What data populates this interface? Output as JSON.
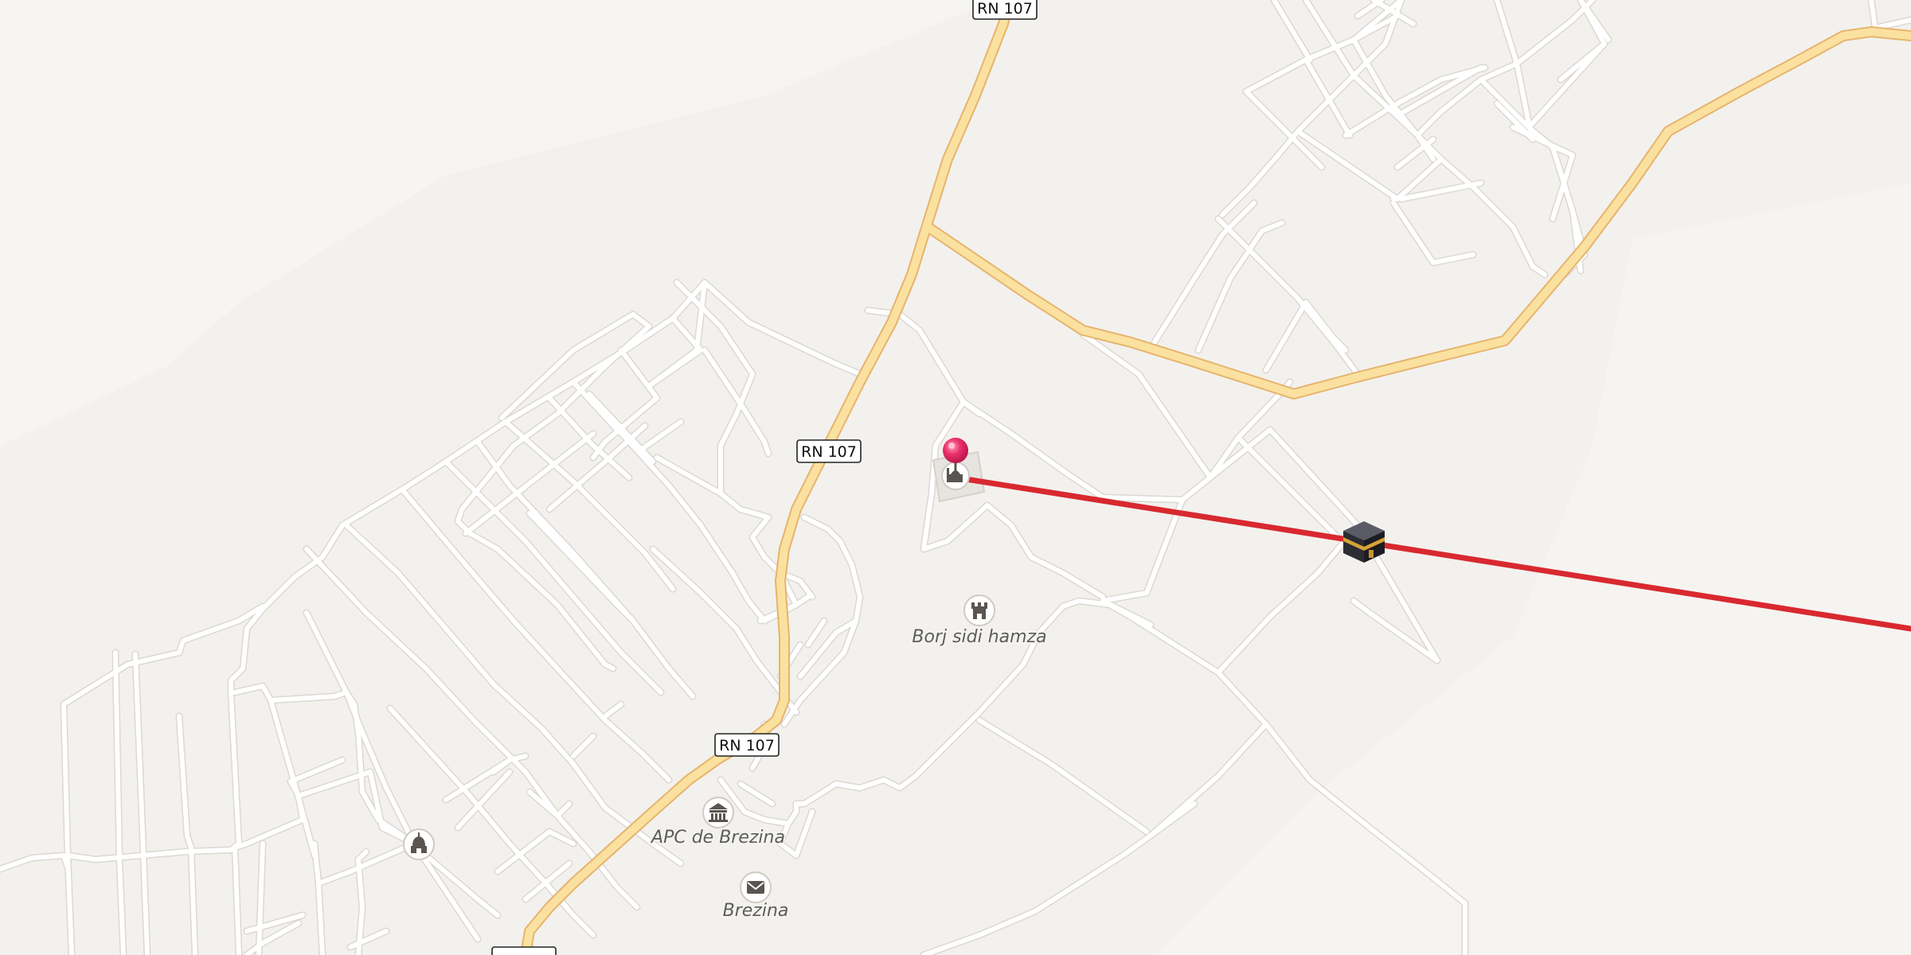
{
  "map": {
    "road_shields": [
      {
        "id": "top",
        "label": "RN 107"
      },
      {
        "id": "middle",
        "label": "RN 107"
      },
      {
        "id": "lower",
        "label": "RN 107"
      }
    ],
    "pois": [
      {
        "id": "borj",
        "label": "Borj sidi hamza",
        "icon": "tower-icon"
      },
      {
        "id": "apc",
        "label": "APC de Brezina",
        "icon": "government-building-icon"
      },
      {
        "id": "post",
        "label": "Brezina",
        "icon": "mail-icon"
      },
      {
        "id": "mosque",
        "label": "",
        "icon": "mosque-icon"
      }
    ],
    "markers": {
      "location_pin": {
        "icon": "location-pin-icon",
        "color": "#e5306a"
      },
      "qibla_target": {
        "icon": "kaaba-icon"
      },
      "qibla_line_color": "#d8292f"
    },
    "colors": {
      "background": "#f3f1ee",
      "street": "#ffffff",
      "major_road_fill": "#fbe1a0",
      "major_road_casing": "#e6b46c"
    }
  }
}
